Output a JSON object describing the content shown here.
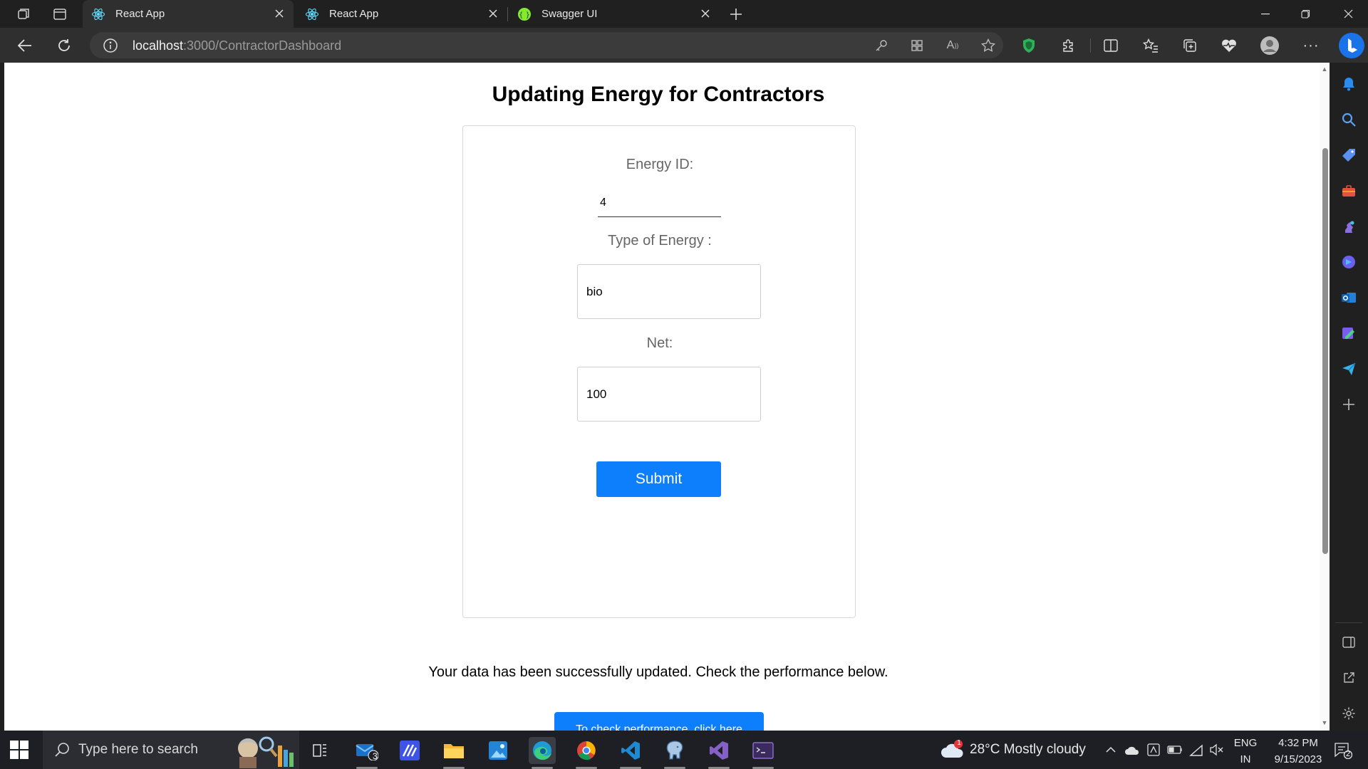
{
  "browser": {
    "tabs": [
      {
        "title": "React App",
        "active": true
      },
      {
        "title": "React App",
        "active": false
      },
      {
        "title": "Swagger UI",
        "active": false
      }
    ],
    "url_host": "localhost",
    "url_path": ":3000/ContractorDashboard"
  },
  "page": {
    "title": "Updating Energy for Contractors",
    "energy_id_label": "Energy ID:",
    "energy_id_value": "4",
    "type_label": "Type of Energy :",
    "type_value": "bio",
    "net_label": "Net:",
    "net_value": "100",
    "submit_label": "Submit",
    "success_message": "Your data has been successfully updated. Check the performance below.",
    "performance_button": "To check performance, click here"
  },
  "taskbar": {
    "search_placeholder": "Type here to search",
    "mail_badge": "3",
    "weather_badge": "1",
    "weather": "28°C  Mostly cloudy",
    "lang_top": "ENG",
    "lang_bottom": "IN",
    "time": "4:32 PM",
    "date": "9/15/2023",
    "notification_count": "2"
  },
  "colors": {
    "primary_button": "#0d7ffc",
    "browser_chrome": "#202020",
    "taskbar": "#1d1f24"
  }
}
